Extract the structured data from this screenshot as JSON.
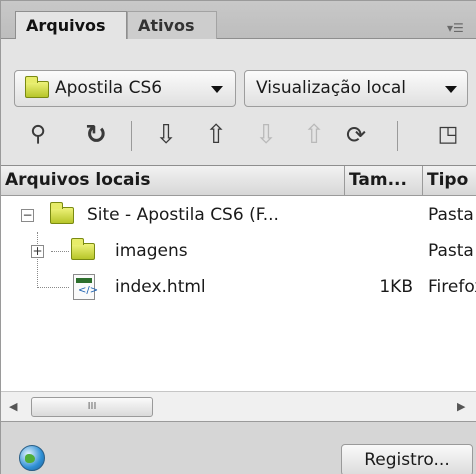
{
  "tabs": [
    {
      "label": "Arquivos"
    },
    {
      "label": "Ativos"
    }
  ],
  "toolbar": {
    "site_select": "Apostila CS6",
    "view_select": "Visualização local",
    "icons": [
      "connect-icon",
      "refresh-icon",
      "get-files-icon",
      "put-files-icon",
      "check-out-icon",
      "check-in-icon",
      "synchronize-icon",
      "expand-icon"
    ]
  },
  "columns": [
    "Arquivos locais",
    "Tam...",
    "Tipo"
  ],
  "rows": [
    {
      "name": "Site - Apostila CS6 (F...",
      "size": "",
      "type": "Pasta"
    },
    {
      "name": "imagens",
      "size": "",
      "type": "Pasta"
    },
    {
      "name": "index.html",
      "size": "1KB",
      "type": "Firefox"
    }
  ],
  "scrollbar": {
    "thumb_label": "III"
  },
  "status": {
    "log_button": "Registro..."
  }
}
